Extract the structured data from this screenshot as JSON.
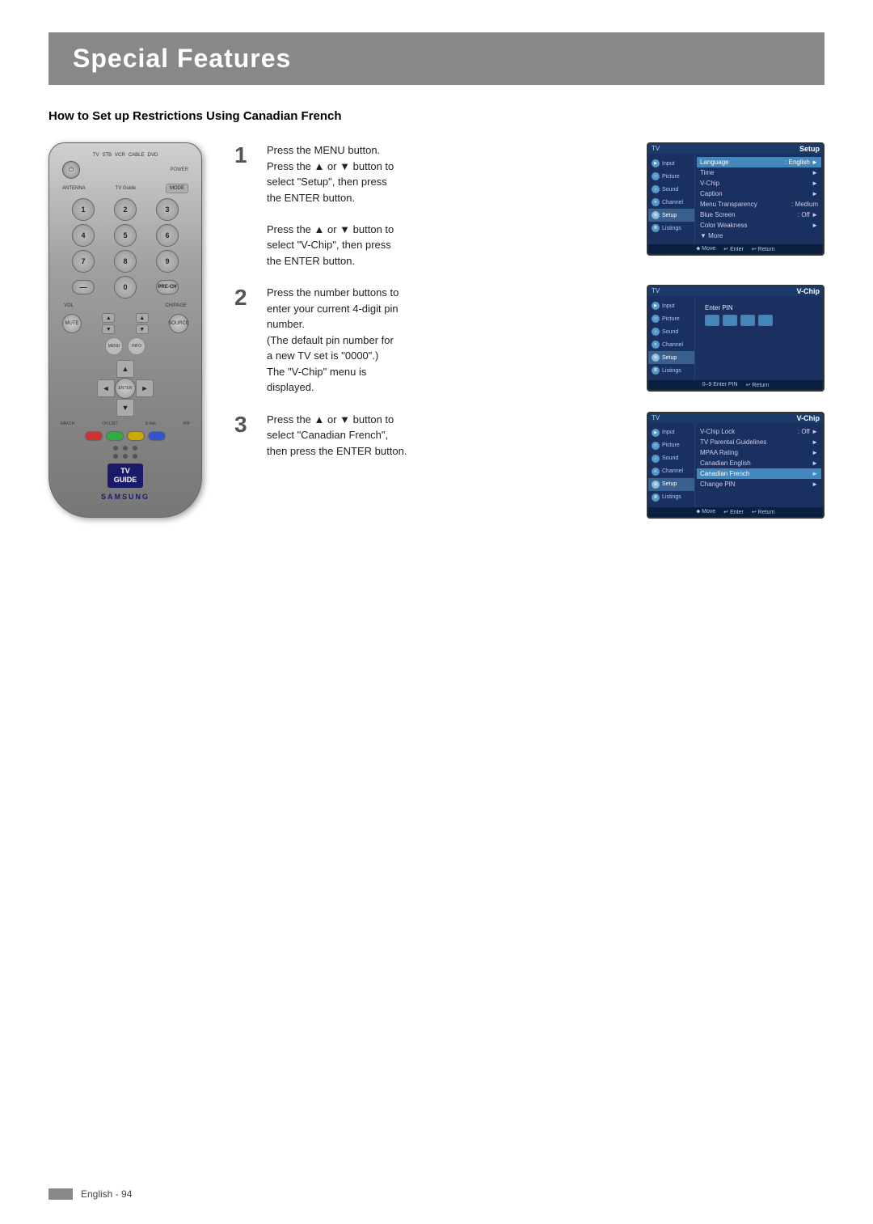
{
  "page": {
    "title": "Special Features",
    "section_heading": "How to Set up Restrictions Using Canadian French",
    "footer_text": "English - 94"
  },
  "step1": {
    "number": "1",
    "lines": [
      "Press the MENU button.",
      "Press the ▲ or ▼ button to",
      "select \"Setup\", then press",
      "the ENTER button.",
      "",
      "Press the ▲ or ▼ button to",
      "select \"V-Chip\", then press",
      "the ENTER button."
    ],
    "screen_title": "Setup",
    "menu_items": [
      {
        "label": "Language",
        "value": ": English",
        "arrow": "►"
      },
      {
        "label": "Time",
        "value": "",
        "arrow": "►"
      },
      {
        "label": "V-Chip",
        "value": "",
        "arrow": "►"
      },
      {
        "label": "Caption",
        "value": "",
        "arrow": "►"
      },
      {
        "label": "Menu Transparency",
        "value": ": Medium",
        "arrow": "►"
      },
      {
        "label": "Blue Screen",
        "value": ": Off",
        "arrow": "►"
      },
      {
        "label": "Color Weakness",
        "value": "",
        "arrow": "►"
      },
      {
        "label": "▼ More",
        "value": "",
        "arrow": ""
      }
    ]
  },
  "step2": {
    "number": "2",
    "lines": [
      "Press the number buttons to",
      "enter your current 4-digit pin",
      "number.",
      "(The default pin number for",
      "a new TV set is \"0000\".)",
      "The \"V-Chip\" menu is",
      "displayed."
    ],
    "screen_title": "V-Chip",
    "enter_pin_label": "Enter PIN"
  },
  "step3": {
    "number": "3",
    "lines": [
      "Press the ▲ or ▼ button to",
      "select \"Canadian French\",",
      "then press the ENTER button."
    ],
    "screen_title": "V-Chip",
    "menu_items": [
      {
        "label": "V-Chip Lock",
        "value": ": Off",
        "arrow": "►"
      },
      {
        "label": "TV Parental Guidelines",
        "value": "",
        "arrow": "►"
      },
      {
        "label": "MPAA Rating",
        "value": "",
        "arrow": "►"
      },
      {
        "label": "Canadian English",
        "value": "",
        "arrow": "►"
      },
      {
        "label": "Canadian French",
        "value": "",
        "arrow": "►",
        "highlighted": true
      },
      {
        "label": "Change PIN",
        "value": "",
        "arrow": "►"
      }
    ]
  },
  "sidebar_items": [
    {
      "label": "Input"
    },
    {
      "label": "Picture"
    },
    {
      "label": "Sound"
    },
    {
      "label": "Channel"
    },
    {
      "label": "Setup",
      "active": true
    },
    {
      "label": "Listings"
    }
  ],
  "remote": {
    "brand": "SAMSUNG",
    "tv_guide": "TV\nGUIDE",
    "power_symbol": "⏻",
    "mode_label": "MODE"
  },
  "colors": {
    "accent_blue": "#1a3a6a",
    "header_bg": "#888888",
    "screen_bg": "#1a3060",
    "highlight": "#4488bb"
  }
}
